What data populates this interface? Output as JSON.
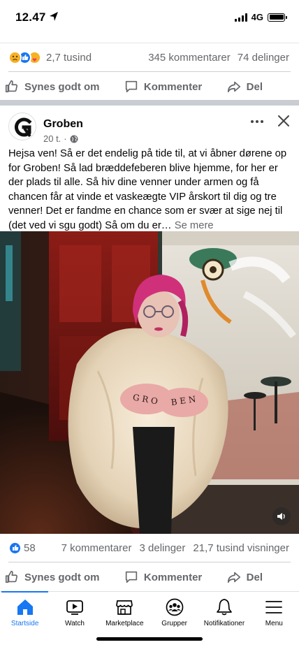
{
  "status_bar": {
    "time": "12.47",
    "network": "4G"
  },
  "previous_post": {
    "reactions_count": "2,7 tusind",
    "comments": "345 kommentarer",
    "shares": "74 delinger"
  },
  "actions": {
    "like": "Synes godt om",
    "comment": "Kommenter",
    "share": "Del"
  },
  "post": {
    "author": "Groben",
    "time": "20 t.",
    "separator": "·",
    "text": "Hejsa ven! Så er det endelig på tide til, at vi åbner dørene op for Groben! Så lad bræddefeberen blive hjemme, for her er der plads til alle. Så hiv dine venner under armen og få chancen får at vinde et vaskeægte VIP årskort til dig og tre venner! Det er fandme en chance som er svær at sige nej til (det ved vi sgu godt) Så om du er…",
    "see_more": "Se mere",
    "reactions_count": "58",
    "comments": "7 kommentarer",
    "shares": "3 delinger",
    "views": "21,7 tusind visninger"
  },
  "bottom_nav": [
    {
      "label": "Startside",
      "icon": "home-icon",
      "active": true
    },
    {
      "label": "Watch",
      "icon": "watch-icon",
      "active": false
    },
    {
      "label": "Marketplace",
      "icon": "marketplace-icon",
      "active": false
    },
    {
      "label": "Grupper",
      "icon": "groups-icon",
      "active": false
    },
    {
      "label": "Notifikationer",
      "icon": "bell-icon",
      "active": false
    },
    {
      "label": "Menu",
      "icon": "menu-icon",
      "active": false
    }
  ],
  "colors": {
    "accent": "#1877f2",
    "secondary_text": "#65676b",
    "like_blue": "#1877f2",
    "love_red": "#f33e58",
    "sad_yellow": "#f7b125"
  }
}
